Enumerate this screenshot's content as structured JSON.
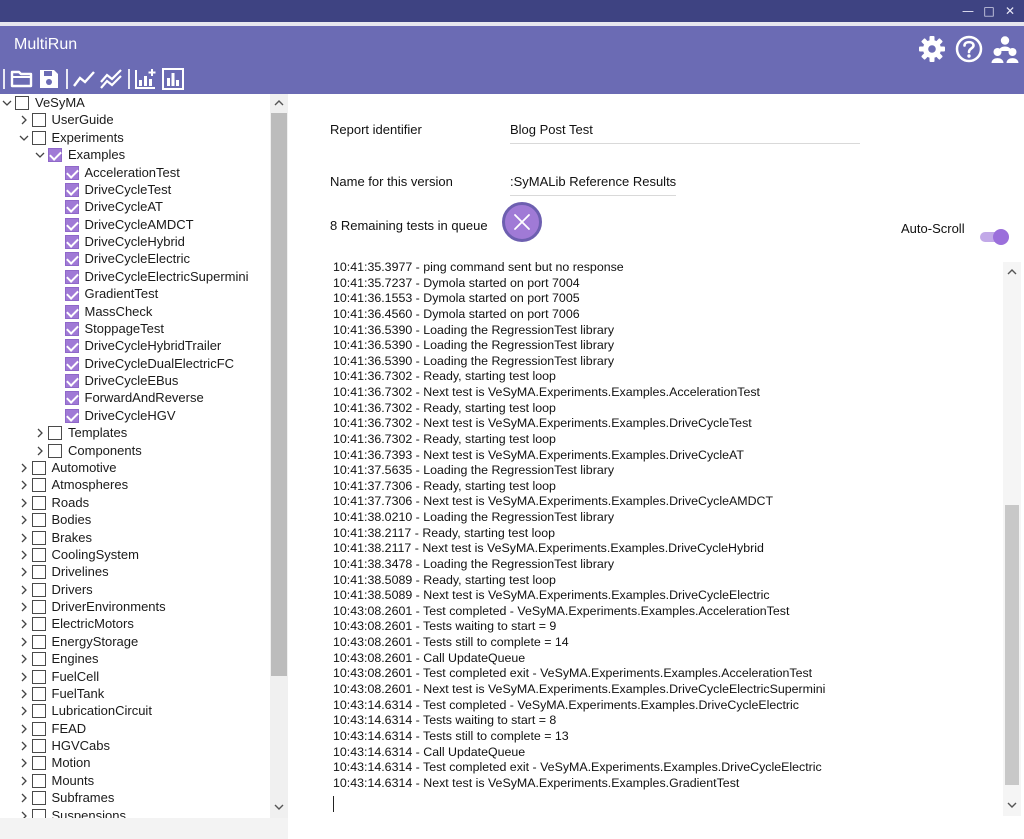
{
  "window": {
    "title": "MultiRun",
    "minimize_glyph": "—",
    "maximize_glyph": "□",
    "close_glyph": "✕"
  },
  "colors": {
    "header": "#6b6bb4",
    "titlebar": "#3e4382",
    "accent": "#a07ad6"
  },
  "header_icons": [
    "gear-icon",
    "help-icon",
    "users-icon"
  ],
  "toolbar": [
    "open-folder-icon",
    "save-icon",
    "line-chart-icon",
    "multi-line-chart-icon",
    "add-chart-icon",
    "bar-chart-icon"
  ],
  "tree": [
    {
      "label": "VeSyMA",
      "level": 0,
      "caret": "open",
      "checked": false
    },
    {
      "label": "UserGuide",
      "level": 1,
      "caret": "closed",
      "checked": false
    },
    {
      "label": "Experiments",
      "level": 1,
      "caret": "open",
      "checked": false
    },
    {
      "label": "Examples",
      "level": 2,
      "caret": "open",
      "checked": true
    },
    {
      "label": "AccelerationTest",
      "level": 3,
      "caret": "none",
      "checked": true
    },
    {
      "label": "DriveCycleTest",
      "level": 3,
      "caret": "none",
      "checked": true
    },
    {
      "label": "DriveCycleAT",
      "level": 3,
      "caret": "none",
      "checked": true
    },
    {
      "label": "DriveCycleAMDCT",
      "level": 3,
      "caret": "none",
      "checked": true
    },
    {
      "label": "DriveCycleHybrid",
      "level": 3,
      "caret": "none",
      "checked": true
    },
    {
      "label": "DriveCycleElectric",
      "level": 3,
      "caret": "none",
      "checked": true
    },
    {
      "label": "DriveCycleElectricSupermini",
      "level": 3,
      "caret": "none",
      "checked": true
    },
    {
      "label": "GradientTest",
      "level": 3,
      "caret": "none",
      "checked": true
    },
    {
      "label": "MassCheck",
      "level": 3,
      "caret": "none",
      "checked": true
    },
    {
      "label": "StoppageTest",
      "level": 3,
      "caret": "none",
      "checked": true
    },
    {
      "label": "DriveCycleHybridTrailer",
      "level": 3,
      "caret": "none",
      "checked": true
    },
    {
      "label": "DriveCycleDualElectricFC",
      "level": 3,
      "caret": "none",
      "checked": true
    },
    {
      "label": "DriveCycleEBus",
      "level": 3,
      "caret": "none",
      "checked": true
    },
    {
      "label": "ForwardAndReverse",
      "level": 3,
      "caret": "none",
      "checked": true
    },
    {
      "label": "DriveCycleHGV",
      "level": 3,
      "caret": "none",
      "checked": true
    },
    {
      "label": "Templates",
      "level": 2,
      "caret": "closed",
      "checked": false
    },
    {
      "label": "Components",
      "level": 2,
      "caret": "closed",
      "checked": false
    },
    {
      "label": "Automotive",
      "level": 1,
      "caret": "closed",
      "checked": false
    },
    {
      "label": "Atmospheres",
      "level": 1,
      "caret": "closed",
      "checked": false
    },
    {
      "label": "Roads",
      "level": 1,
      "caret": "closed",
      "checked": false
    },
    {
      "label": "Bodies",
      "level": 1,
      "caret": "closed",
      "checked": false
    },
    {
      "label": "Brakes",
      "level": 1,
      "caret": "closed",
      "checked": false
    },
    {
      "label": "CoolingSystem",
      "level": 1,
      "caret": "closed",
      "checked": false
    },
    {
      "label": "Drivelines",
      "level": 1,
      "caret": "closed",
      "checked": false
    },
    {
      "label": "Drivers",
      "level": 1,
      "caret": "closed",
      "checked": false
    },
    {
      "label": "DriverEnvironments",
      "level": 1,
      "caret": "closed",
      "checked": false
    },
    {
      "label": "ElectricMotors",
      "level": 1,
      "caret": "closed",
      "checked": false
    },
    {
      "label": "EnergyStorage",
      "level": 1,
      "caret": "closed",
      "checked": false
    },
    {
      "label": "Engines",
      "level": 1,
      "caret": "closed",
      "checked": false
    },
    {
      "label": "FuelCell",
      "level": 1,
      "caret": "closed",
      "checked": false
    },
    {
      "label": "FuelTank",
      "level": 1,
      "caret": "closed",
      "checked": false
    },
    {
      "label": "LubricationCircuit",
      "level": 1,
      "caret": "closed",
      "checked": false
    },
    {
      "label": "FEAD",
      "level": 1,
      "caret": "closed",
      "checked": false
    },
    {
      "label": "HGVCabs",
      "level": 1,
      "caret": "closed",
      "checked": false
    },
    {
      "label": "Motion",
      "level": 1,
      "caret": "closed",
      "checked": false
    },
    {
      "label": "Mounts",
      "level": 1,
      "caret": "closed",
      "checked": false
    },
    {
      "label": "Subframes",
      "level": 1,
      "caret": "closed",
      "checked": false
    },
    {
      "label": "Suspensions",
      "level": 1,
      "caret": "closed",
      "checked": false
    }
  ],
  "form": {
    "report_identifier_label": "Report identifier",
    "report_identifier_value": "Blog Post Test",
    "version_name_label": "Name for this version",
    "version_name_value": ":SyMALib Reference Results",
    "queue_status": "8  Remaining tests in queue",
    "autoscroll_label": "Auto-Scroll",
    "autoscroll_on": true
  },
  "log": [
    "10:41:35.3977 - ping command sent but no response",
    "10:41:35.7237 - Dymola started on port 7004",
    "10:41:36.1553 - Dymola started on port 7005",
    "10:41:36.4560 - Dymola started on port 7006",
    "10:41:36.5390 - Loading the RegressionTest library",
    "10:41:36.5390 - Loading the RegressionTest library",
    "10:41:36.5390 - Loading the RegressionTest library",
    "10:41:36.7302 - Ready, starting test loop",
    "10:41:36.7302 - Next test is VeSyMA.Experiments.Examples.AccelerationTest",
    "10:41:36.7302 - Ready, starting test loop",
    "10:41:36.7302 - Next test is VeSyMA.Experiments.Examples.DriveCycleTest",
    "10:41:36.7302 - Ready, starting test loop",
    "10:41:36.7393 - Next test is VeSyMA.Experiments.Examples.DriveCycleAT",
    "10:41:37.5635 - Loading the RegressionTest library",
    "10:41:37.7306 - Ready, starting test loop",
    "10:41:37.7306 - Next test is VeSyMA.Experiments.Examples.DriveCycleAMDCT",
    "10:41:38.0210 - Loading the RegressionTest library",
    "10:41:38.2117 - Ready, starting test loop",
    "10:41:38.2117 - Next test is VeSyMA.Experiments.Examples.DriveCycleHybrid",
    "10:41:38.3478 - Loading the RegressionTest library",
    "10:41:38.5089 - Ready, starting test loop",
    "10:41:38.5089 - Next test is VeSyMA.Experiments.Examples.DriveCycleElectric",
    "10:43:08.2601 - Test completed - VeSyMA.Experiments.Examples.AccelerationTest",
    "10:43:08.2601 - Tests waiting to start = 9",
    "10:43:08.2601 - Tests still to complete = 14",
    "10:43:08.2601 - Call UpdateQueue",
    "10:43:08.2601 - Test completed exit - VeSyMA.Experiments.Examples.AccelerationTest",
    "10:43:08.2601 - Next test is VeSyMA.Experiments.Examples.DriveCycleElectricSupermini",
    "10:43:14.6314 - Test completed - VeSyMA.Experiments.Examples.DriveCycleElectric",
    "10:43:14.6314 - Tests waiting to start = 8",
    "10:43:14.6314 - Tests still to complete = 13",
    "10:43:14.6314 - Call UpdateQueue",
    "10:43:14.6314 - Test completed exit - VeSyMA.Experiments.Examples.DriveCycleElectric",
    "10:43:14.6314 - Next test is VeSyMA.Experiments.Examples.GradientTest"
  ]
}
